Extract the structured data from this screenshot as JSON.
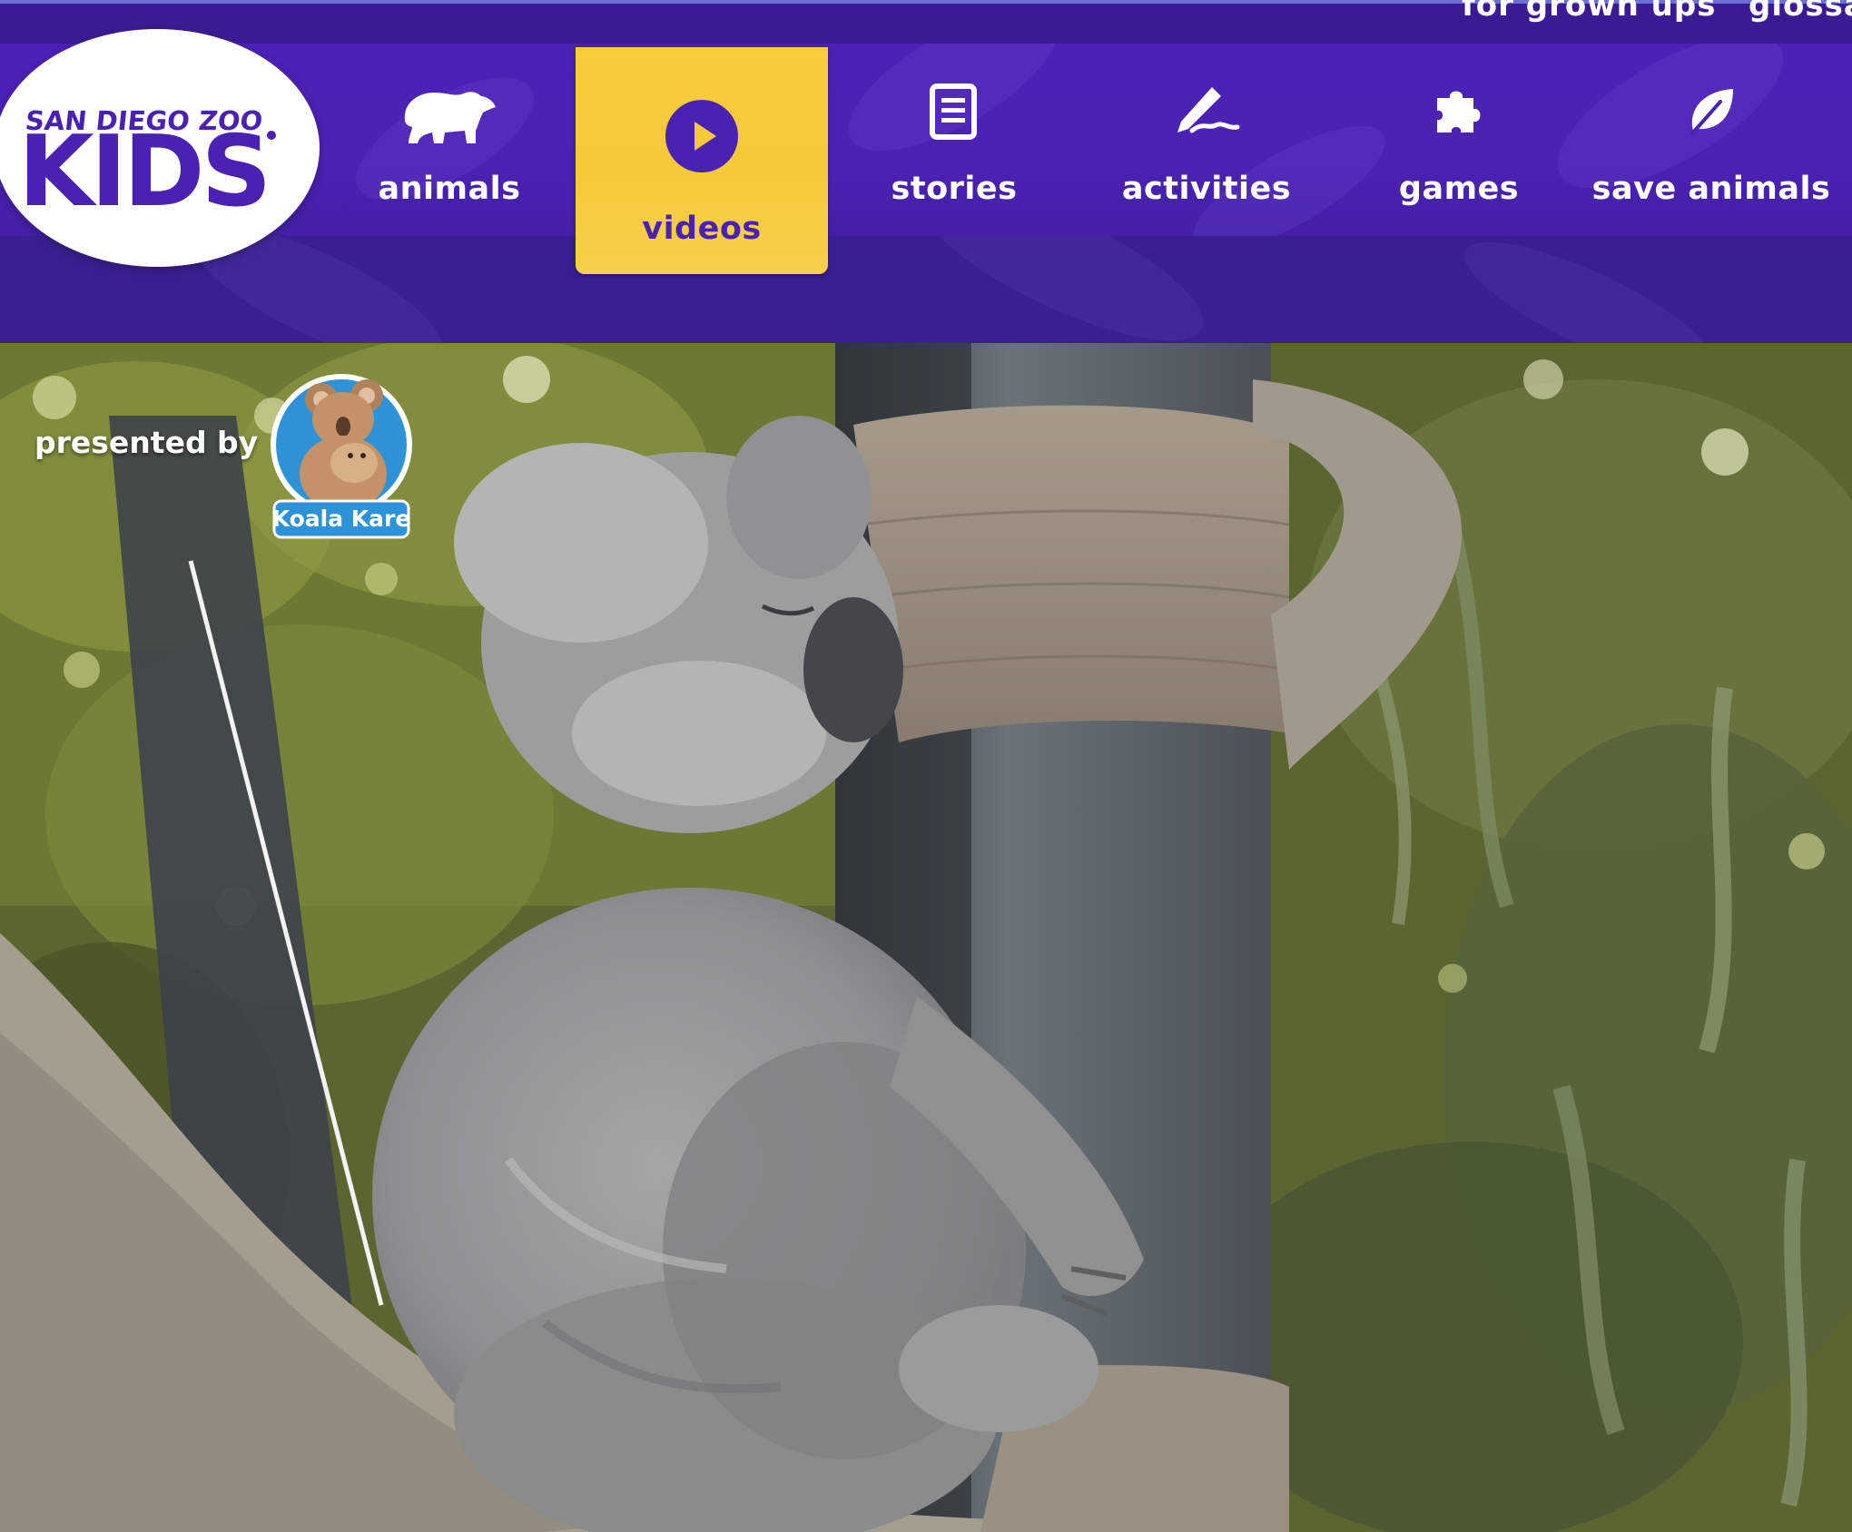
{
  "header": {
    "top_links": [
      {
        "label": "for grown ups"
      },
      {
        "label": "glossary"
      }
    ],
    "logo": {
      "top_text": "SAN DIEGO ZOO",
      "main_text": "KIDS"
    }
  },
  "nav": {
    "items": [
      {
        "label": "animals",
        "icon": "bear-icon",
        "active": false
      },
      {
        "label": "videos",
        "icon": "play-circle-icon",
        "active": true
      },
      {
        "label": "stories",
        "icon": "document-icon",
        "active": false
      },
      {
        "label": "activities",
        "icon": "pencil-icon",
        "active": false
      },
      {
        "label": "games",
        "icon": "puzzle-icon",
        "active": false
      },
      {
        "label": "save animals",
        "icon": "leaf-icon",
        "active": false
      }
    ]
  },
  "video": {
    "presented_by": "presented by",
    "sponsor_label": "Koala Kare"
  },
  "colors": {
    "nav_purple": "#4a22b3",
    "dark_purple": "#3b1f92",
    "active_yellow": "#f5c93a"
  }
}
